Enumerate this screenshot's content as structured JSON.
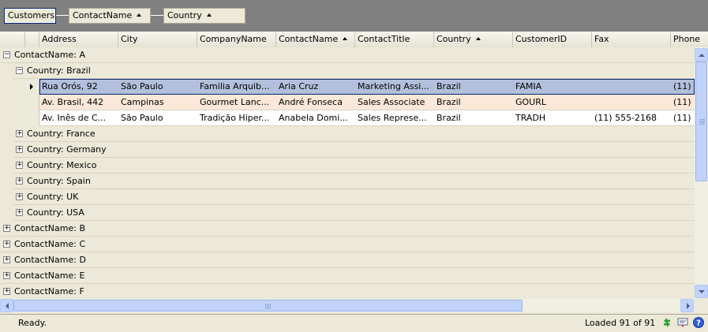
{
  "group_panel": {
    "chips": [
      {
        "label": "Customers",
        "sorted": false
      },
      {
        "label": "ContactName",
        "sorted": true
      },
      {
        "label": "Country",
        "sorted": true
      }
    ]
  },
  "columns": [
    {
      "label": "Address",
      "sorted": false
    },
    {
      "label": "City",
      "sorted": false
    },
    {
      "label": "CompanyName",
      "sorted": false
    },
    {
      "label": "ContactName",
      "sorted": true
    },
    {
      "label": "ContactTitle",
      "sorted": false
    },
    {
      "label": "Country",
      "sorted": true
    },
    {
      "label": "CustomerID",
      "sorted": false
    },
    {
      "label": "Fax",
      "sorted": false
    },
    {
      "label": "Phone",
      "sorted": false
    }
  ],
  "rows": [
    {
      "kind": "group",
      "level": 0,
      "expanded": true,
      "label": "ContactName: A"
    },
    {
      "kind": "group",
      "level": 1,
      "expanded": true,
      "label": "Country: Brazil"
    },
    {
      "kind": "data",
      "state": "selected",
      "cells": [
        "Rua Orós, 92",
        "São Paulo",
        "Familia Arquib...",
        "Aria Cruz",
        "Marketing Assi...",
        "Brazil",
        "FAMIA",
        "",
        "(11)"
      ]
    },
    {
      "kind": "data",
      "state": "alt",
      "cells": [
        "Av. Brasil, 442",
        "Campinas",
        "Gourmet Lanc...",
        "André Fonseca",
        "Sales Associate",
        "Brazil",
        "GOURL",
        "",
        "(11)"
      ]
    },
    {
      "kind": "data",
      "state": "normal",
      "cells": [
        "Av. Inês de C...",
        "São Paulo",
        "Tradição Hiper...",
        "Anabela Domi...",
        "Sales Represe...",
        "Brazil",
        "TRADH",
        "(11) 555-2168",
        "(11)"
      ]
    },
    {
      "kind": "group",
      "level": 1,
      "expanded": false,
      "label": "Country: France"
    },
    {
      "kind": "group",
      "level": 1,
      "expanded": false,
      "label": "Country: Germany"
    },
    {
      "kind": "group",
      "level": 1,
      "expanded": false,
      "label": "Country: Mexico"
    },
    {
      "kind": "group",
      "level": 1,
      "expanded": false,
      "label": "Country: Spain"
    },
    {
      "kind": "group",
      "level": 1,
      "expanded": false,
      "label": "Country: UK"
    },
    {
      "kind": "group",
      "level": 1,
      "expanded": false,
      "label": "Country: USA"
    },
    {
      "kind": "group",
      "level": 0,
      "expanded": false,
      "label": "ContactName: B"
    },
    {
      "kind": "group",
      "level": 0,
      "expanded": false,
      "label": "ContactName: C"
    },
    {
      "kind": "group",
      "level": 0,
      "expanded": false,
      "label": "ContactName: D"
    },
    {
      "kind": "group",
      "level": 0,
      "expanded": false,
      "label": "ContactName: E"
    },
    {
      "kind": "group",
      "level": 0,
      "expanded": false,
      "label": "ContactName: F"
    }
  ],
  "status": {
    "text": "Ready.",
    "loaded": "Loaded 91 of 91",
    "icons": [
      "refresh-icon",
      "filter-icon",
      "help-icon"
    ]
  },
  "colors": {
    "group_panel_bg": "#808080",
    "selected_row": "#b2c0dd",
    "alt_row": "#fbe8d8",
    "accent": "#0a246a"
  }
}
